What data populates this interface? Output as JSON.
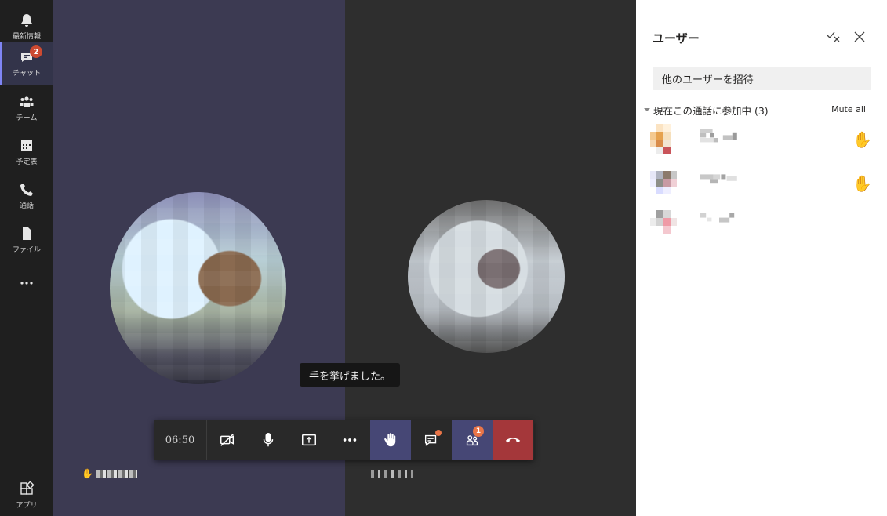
{
  "rail": {
    "items": [
      {
        "label": "最新情報",
        "icon": "bell-icon"
      },
      {
        "label": "チャット",
        "icon": "chat-icon",
        "badge": "2",
        "active": true
      },
      {
        "label": "チーム",
        "icon": "teams-icon"
      },
      {
        "label": "予定表",
        "icon": "calendar-icon"
      },
      {
        "label": "通話",
        "icon": "phone-icon"
      },
      {
        "label": "ファイル",
        "icon": "file-icon"
      },
      {
        "label": "",
        "icon": "more-icon"
      },
      {
        "label": "アプリ",
        "icon": "apps-icon"
      }
    ]
  },
  "stage": {
    "toast": "手を挙げました。",
    "left_name_icon": "✋"
  },
  "callbar": {
    "time": "06:50",
    "people_badge": "1"
  },
  "panel": {
    "title": "ユーザー",
    "invite_placeholder": "他のユーザーを招待",
    "section_label": "現在この通話に参加中 (3)",
    "mute_all": "Mute all",
    "participants": [
      {
        "hand": "✋"
      },
      {
        "hand": "✋"
      },
      {
        "hand": ""
      }
    ]
  },
  "colors": {
    "accent": "#464775",
    "hangup": "#a4373a",
    "badge": "#cc4a31",
    "notify": "#e97548"
  }
}
